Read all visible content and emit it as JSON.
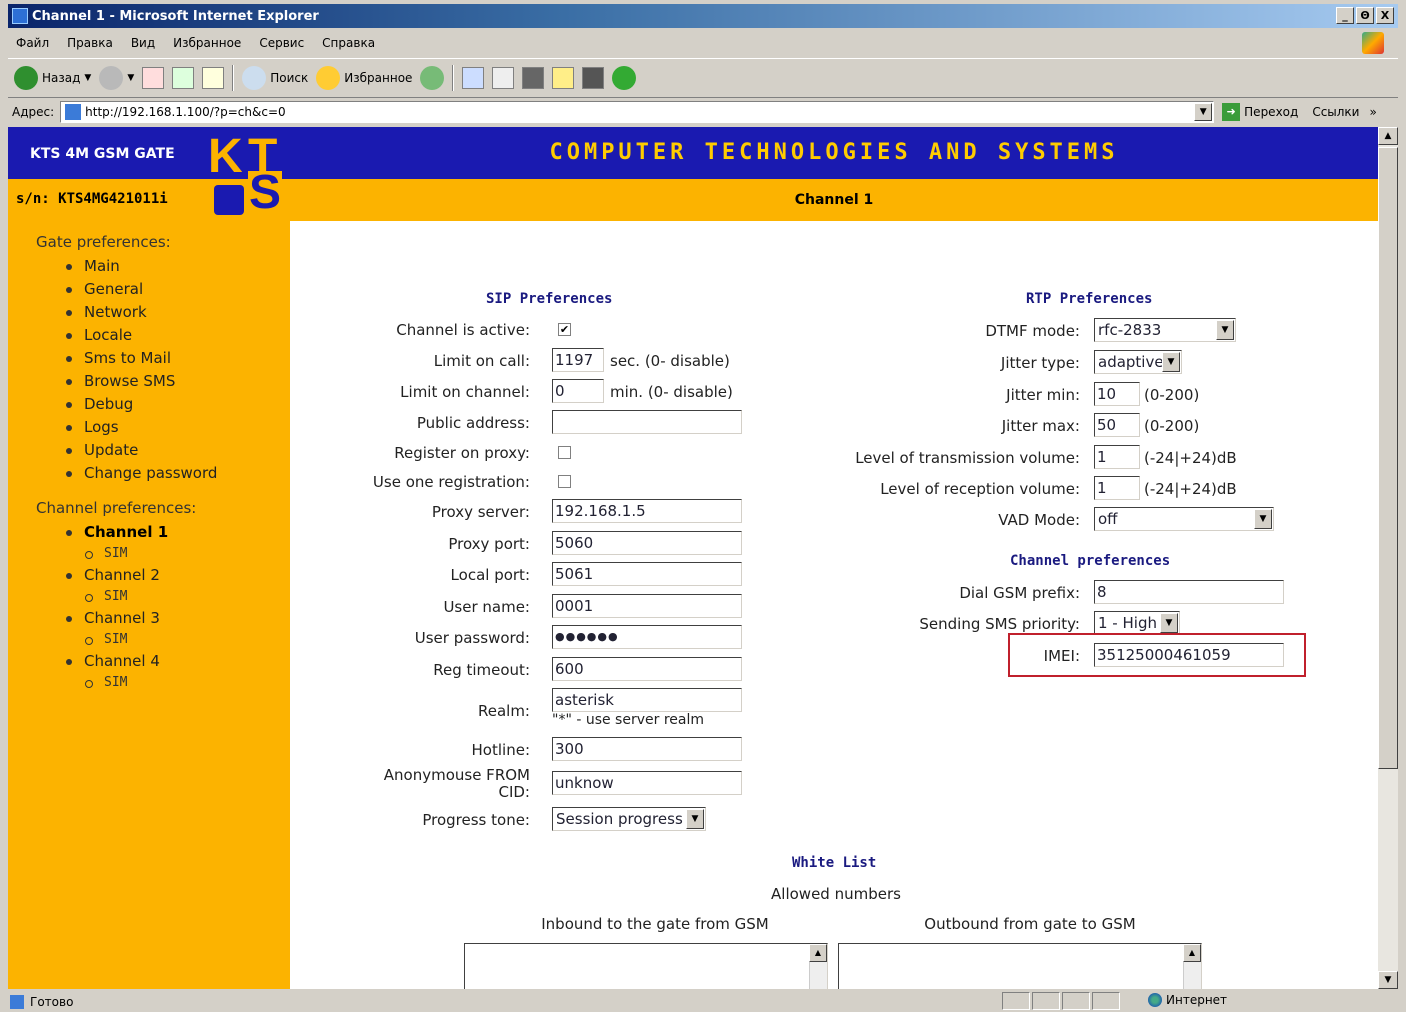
{
  "window": {
    "title": "Channel 1 - Microsoft Internet Explorer",
    "buttons": [
      "_",
      "Θ",
      "X"
    ]
  },
  "menubar": [
    "Файл",
    "Правка",
    "Вид",
    "Избранное",
    "Сервис",
    "Справка"
  ],
  "toolbar": {
    "back": "Назад",
    "search": "Поиск",
    "favorites": "Избранное"
  },
  "address": {
    "label": "Адрес:",
    "url": "http://192.168.1.100/?p=ch&c=0",
    "go": "Переход",
    "links": "Ссылки",
    "more": "»"
  },
  "header": {
    "brand": "KTS 4M GSM GATE",
    "banner": "COMPUTER TECHNOLOGIES AND SYSTEMS",
    "serial": "s/n: KTS4MG421011i",
    "page_title": "Channel 1",
    "logo": [
      "K",
      "T",
      "S"
    ]
  },
  "sidebar": {
    "gate_title": "Gate preferences:",
    "gate_items": [
      "Main",
      "General",
      "Network",
      "Locale",
      "Sms to Mail",
      "Browse SMS",
      "Debug",
      "Logs",
      "Update",
      "Change password"
    ],
    "channel_title": "Channel preferences:",
    "channels": [
      {
        "label": "Channel 1",
        "sub": "SIM",
        "active": true
      },
      {
        "label": "Channel 2",
        "sub": "SIM",
        "active": false
      },
      {
        "label": "Channel 3",
        "sub": "SIM",
        "active": false
      },
      {
        "label": "Channel 4",
        "sub": "SIM",
        "active": false
      }
    ]
  },
  "sip": {
    "title": "SIP Preferences",
    "channel_active_label": "Channel is active:",
    "channel_active": true,
    "limit_call_label": "Limit on call:",
    "limit_call": "1197",
    "limit_call_note": "sec. (0- disable)",
    "limit_channel_label": "Limit on channel:",
    "limit_channel": "0",
    "limit_channel_note": "min. (0- disable)",
    "public_address_label": "Public address:",
    "public_address": "",
    "register_proxy_label": "Register on proxy:",
    "register_proxy": false,
    "one_registration_label": "Use one registration:",
    "one_registration": false,
    "proxy_server_label": "Proxy server:",
    "proxy_server": "192.168.1.5",
    "proxy_port_label": "Proxy port:",
    "proxy_port": "5060",
    "local_port_label": "Local port:",
    "local_port": "5061",
    "user_name_label": "User name:",
    "user_name": "0001",
    "user_password_label": "User password:",
    "user_password": "●●●●●●",
    "reg_timeout_label": "Reg timeout:",
    "reg_timeout": "600",
    "realm_label": "Realm:",
    "realm": "asterisk",
    "realm_note": "\"*\" - use server realm",
    "hotline_label": "Hotline:",
    "hotline": "300",
    "anon_from_label_1": "Anonymouse FROM",
    "anon_from_label_2": "CID:",
    "anon_from": "unknow",
    "progress_tone_label": "Progress tone:",
    "progress_tone": "Session progress"
  },
  "rtp": {
    "title": "RTP Preferences",
    "dtmf_label": "DTMF mode:",
    "dtmf": "rfc-2833",
    "jitter_type_label": "Jitter type:",
    "jitter_type": "adaptive",
    "jitter_min_label": "Jitter min:",
    "jitter_min": "10",
    "jitter_min_note": "(0-200)",
    "jitter_max_label": "Jitter max:",
    "jitter_max": "50",
    "jitter_max_note": "(0-200)",
    "tx_vol_label": "Level of transmission volume:",
    "tx_vol": "1",
    "tx_vol_note": "(-24|+24)dB",
    "rx_vol_label": "Level of reception volume:",
    "rx_vol": "1",
    "rx_vol_note": "(-24|+24)dB",
    "vad_label": "VAD Mode:",
    "vad": "off"
  },
  "channel_prefs": {
    "title": "Channel preferences",
    "dial_prefix_label": "Dial GSM prefix:",
    "dial_prefix": "8",
    "sms_priority_label": "Sending SMS priority:",
    "sms_priority": "1 - High",
    "imei_label": "IMEI:",
    "imei": "35125000461059"
  },
  "white_list": {
    "title": "White List",
    "subtitle": "Allowed numbers",
    "inbound_label": "Inbound to the gate from GSM",
    "outbound_label": "Outbound from gate to GSM"
  },
  "status": {
    "text": "Готово",
    "zone": "Интернет"
  }
}
